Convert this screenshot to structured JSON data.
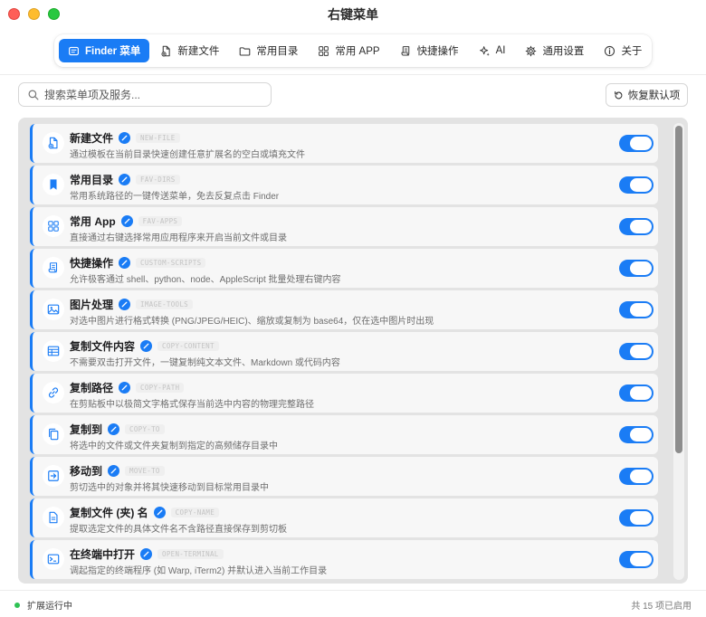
{
  "window": {
    "title": "右键菜单"
  },
  "tabs": [
    {
      "label": "Finder 菜单",
      "icon": "finder-menu-icon",
      "active": true
    },
    {
      "label": "新建文件",
      "icon": "new-file-icon",
      "active": false
    },
    {
      "label": "常用目录",
      "icon": "folder-icon",
      "active": false
    },
    {
      "label": "常用 APP",
      "icon": "apps-grid-icon",
      "active": false
    },
    {
      "label": "快捷操作",
      "icon": "script-icon",
      "active": false
    },
    {
      "label": "AI",
      "icon": "sparkle-icon",
      "active": false
    },
    {
      "label": "通用设置",
      "icon": "gear-icon",
      "active": false
    },
    {
      "label": "关于",
      "icon": "info-icon",
      "active": false
    }
  ],
  "search": {
    "placeholder": "搜索菜单项及服务...",
    "value": ""
  },
  "reset_button": {
    "label": "恢复默认项",
    "icon": "reset-icon"
  },
  "items": [
    {
      "name": "新建文件",
      "code": "NEW-FILE",
      "desc": "通过模板在当前目录快速创建任意扩展名的空白或填充文件",
      "icon": "new-file-icon",
      "enabled": true
    },
    {
      "name": "常用目录",
      "code": "FAV-DIRS",
      "desc": "常用系统路径的一键传送菜单，免去反复点击 Finder",
      "icon": "bookmark-icon",
      "enabled": true
    },
    {
      "name": "常用 App",
      "code": "FAV-APPS",
      "desc": "直接通过右键选择常用应用程序来开启当前文件或目录",
      "icon": "apps-grid-icon",
      "enabled": true
    },
    {
      "name": "快捷操作",
      "code": "CUSTOM-SCRIPTS",
      "desc": "允许极客通过 shell、python、node、AppleScript 批量处理右键内容",
      "icon": "script-icon",
      "enabled": true
    },
    {
      "name": "图片处理",
      "code": "IMAGE-TOOLS",
      "desc": "对选中图片进行格式转换 (PNG/JPEG/HEIC)、缩放或复制为 base64，仅在选中图片时出现",
      "icon": "image-icon",
      "enabled": true
    },
    {
      "name": "复制文件内容",
      "code": "COPY-CONTENT",
      "desc": "不需要双击打开文件，一键复制纯文本文件、Markdown 或代码内容",
      "icon": "table-icon",
      "enabled": true
    },
    {
      "name": "复制路径",
      "code": "COPY-PATH",
      "desc": "在剪贴板中以极简文字格式保存当前选中内容的物理完整路径",
      "icon": "link-icon",
      "enabled": true
    },
    {
      "name": "复制到",
      "code": "COPY-TO",
      "desc": "将选中的文件或文件夹复制到指定的高频储存目录中",
      "icon": "copy-icon",
      "enabled": true
    },
    {
      "name": "移动到",
      "code": "MOVE-TO",
      "desc": "剪切选中的对象并将其快速移动到目标常用目录中",
      "icon": "move-icon",
      "enabled": true
    },
    {
      "name": "复制文件 (夹) 名",
      "code": "COPY-NAME",
      "desc": "提取选定文件的具体文件名不含路径直接保存到剪切板",
      "icon": "document-icon",
      "enabled": true
    },
    {
      "name": "在终端中打开",
      "code": "OPEN-TERMINAL",
      "desc": "调起指定的终端程序 (如 Warp, iTerm2) 并默认进入当前工作目录",
      "icon": "terminal-icon",
      "enabled": true
    }
  ],
  "status": {
    "running_label": "扩展运行中",
    "count_label": "共 15 项已启用"
  },
  "colors": {
    "accent": "#1a7cf5",
    "running": "#2fc254"
  }
}
